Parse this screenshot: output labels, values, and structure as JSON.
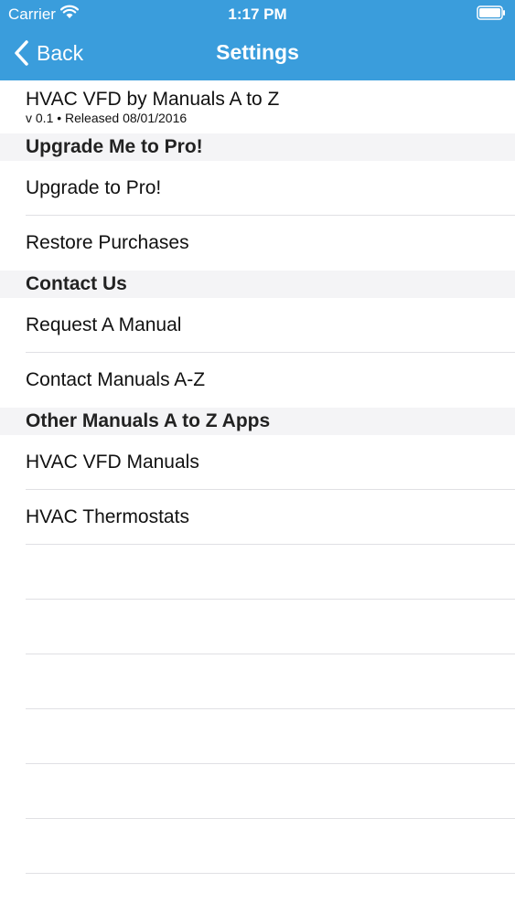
{
  "status_bar": {
    "carrier": "Carrier",
    "time": "1:17 PM"
  },
  "nav": {
    "back_label": "Back",
    "title": "Settings"
  },
  "app_info": {
    "name": "HVAC VFD by Manuals A to Z",
    "version": "v 0.1 • Released 08/01/2016"
  },
  "sections": [
    {
      "title": "Upgrade Me to Pro!",
      "items": [
        "Upgrade to Pro!",
        "Restore Purchases"
      ]
    },
    {
      "title": "Contact Us",
      "items": [
        "Request A Manual",
        "Contact Manuals A-Z"
      ]
    },
    {
      "title": "Other Manuals A to Z Apps",
      "items": [
        "HVAC VFD Manuals",
        "HVAC Thermostats"
      ]
    }
  ],
  "colors": {
    "nav_background": "#3a9ddc",
    "section_background": "#f4f4f6"
  }
}
